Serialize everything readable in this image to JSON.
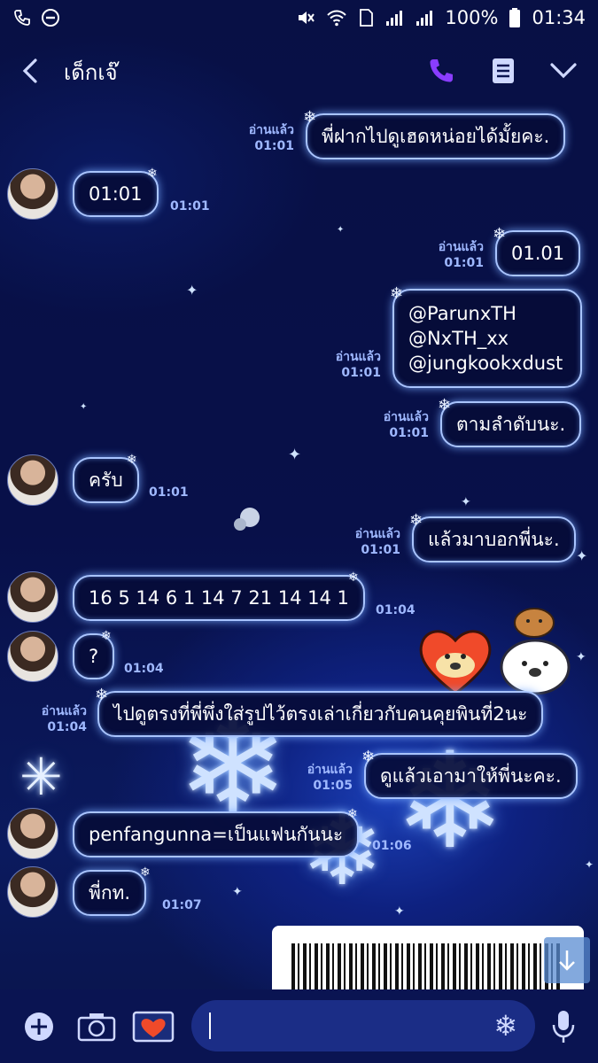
{
  "status_bar": {
    "battery": "100%",
    "time": "01:34"
  },
  "header": {
    "title": "เด็กเจ๊"
  },
  "messages": [
    {
      "side": "out",
      "text": "พี่ฝากไปดูเฮดหน่อยได้มั้ยคะ.",
      "read": "อ่านแล้ว",
      "time": "01:01"
    },
    {
      "side": "in",
      "text": "01:01",
      "time": "01:01"
    },
    {
      "side": "out",
      "text": "01.01",
      "read": "อ่านแล้ว",
      "time": "01:01"
    },
    {
      "side": "out",
      "lines": [
        "@ParunxTH",
        "@NxTH_xx",
        "@jungkookxdust"
      ],
      "read": "อ่านแล้ว",
      "time": "01:01"
    },
    {
      "side": "out",
      "text": "ตามลำดับนะ.",
      "read": "อ่านแล้ว",
      "time": "01:01"
    },
    {
      "side": "in",
      "text": "ครับ",
      "time": "01:01"
    },
    {
      "side": "out",
      "text": "แล้วมาบอกพี่นะ.",
      "read": "อ่านแล้ว",
      "time": "01:01"
    },
    {
      "side": "in",
      "text": "16 5 14 6 1 14 7 21 14 14 1",
      "time": "01:04"
    },
    {
      "side": "in",
      "text": "?",
      "time": "01:04"
    },
    {
      "side": "out",
      "text": "ไปดูตรงที่พี่พึ่งใส่รูปไว้ตรงเล่าเกี่ยวกับคนคุยพินที่2นะ",
      "read": "อ่านแล้ว",
      "time": "01:04"
    },
    {
      "side": "out",
      "text": "ดูแล้วเอามาให้พี่นะคะ.",
      "read": "อ่านแล้ว",
      "time": "01:05"
    },
    {
      "side": "in",
      "text": "penfangunna=เป็นแฟนกันนะ",
      "time": "01:06"
    },
    {
      "side": "in",
      "text": "พี่กท.",
      "time": "01:07"
    }
  ],
  "colors": {
    "background": "#081045",
    "bubble_border": "#a9c4ff",
    "meta_text": "#9fb8ff",
    "call_icon": "#8a3dff"
  },
  "icons": [
    "back-arrow-icon",
    "phone-icon",
    "notes-icon",
    "chevron-down-icon",
    "plus-icon",
    "camera-icon",
    "image-icon",
    "snowflake-icon",
    "mic-icon",
    "scroll-down-icon"
  ]
}
